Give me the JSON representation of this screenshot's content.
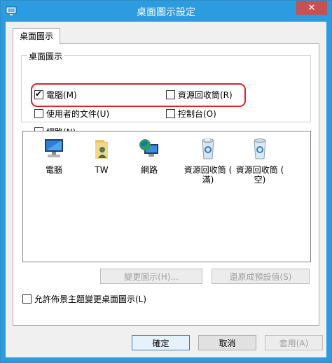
{
  "window": {
    "title": "桌面圖示設定",
    "close_label": "✕"
  },
  "tabs": [
    {
      "label": "桌面圖示"
    }
  ],
  "group": {
    "legend": "桌面圖示"
  },
  "checkboxes": {
    "computer": {
      "label": "電腦(M)",
      "checked": true
    },
    "recycle_bin": {
      "label": "資源回收筒(R)",
      "checked": false
    },
    "user_files": {
      "label": "使用者的文件(U)",
      "checked": false
    },
    "control_panel": {
      "label": "控制台(O)",
      "checked": false
    },
    "network": {
      "label": "網路(N)",
      "checked": false
    },
    "allow_themes": {
      "label": "允許佈景主題變更桌面圖示(L)",
      "checked": false
    }
  },
  "icons": [
    {
      "label": "電腦",
      "icon": "computer-icon"
    },
    {
      "label": "TW",
      "icon": "user-folder-icon"
    },
    {
      "label": "網路",
      "icon": "network-icon"
    },
    {
      "label": "資源回收筒 ( 滿)",
      "icon": "recycle-bin-full-icon"
    },
    {
      "label": "資源回收筒 ( 空)",
      "icon": "recycle-bin-empty-icon"
    }
  ],
  "buttons": {
    "change_icon": "變更圖示(H)...",
    "restore_default": "還原成預設值(S)",
    "ok": "確定",
    "cancel": "取消",
    "apply": "套用(A)"
  },
  "colors": {
    "titlebar": "#2d9be0",
    "close": "#c75050",
    "highlight": "#e0202a"
  }
}
